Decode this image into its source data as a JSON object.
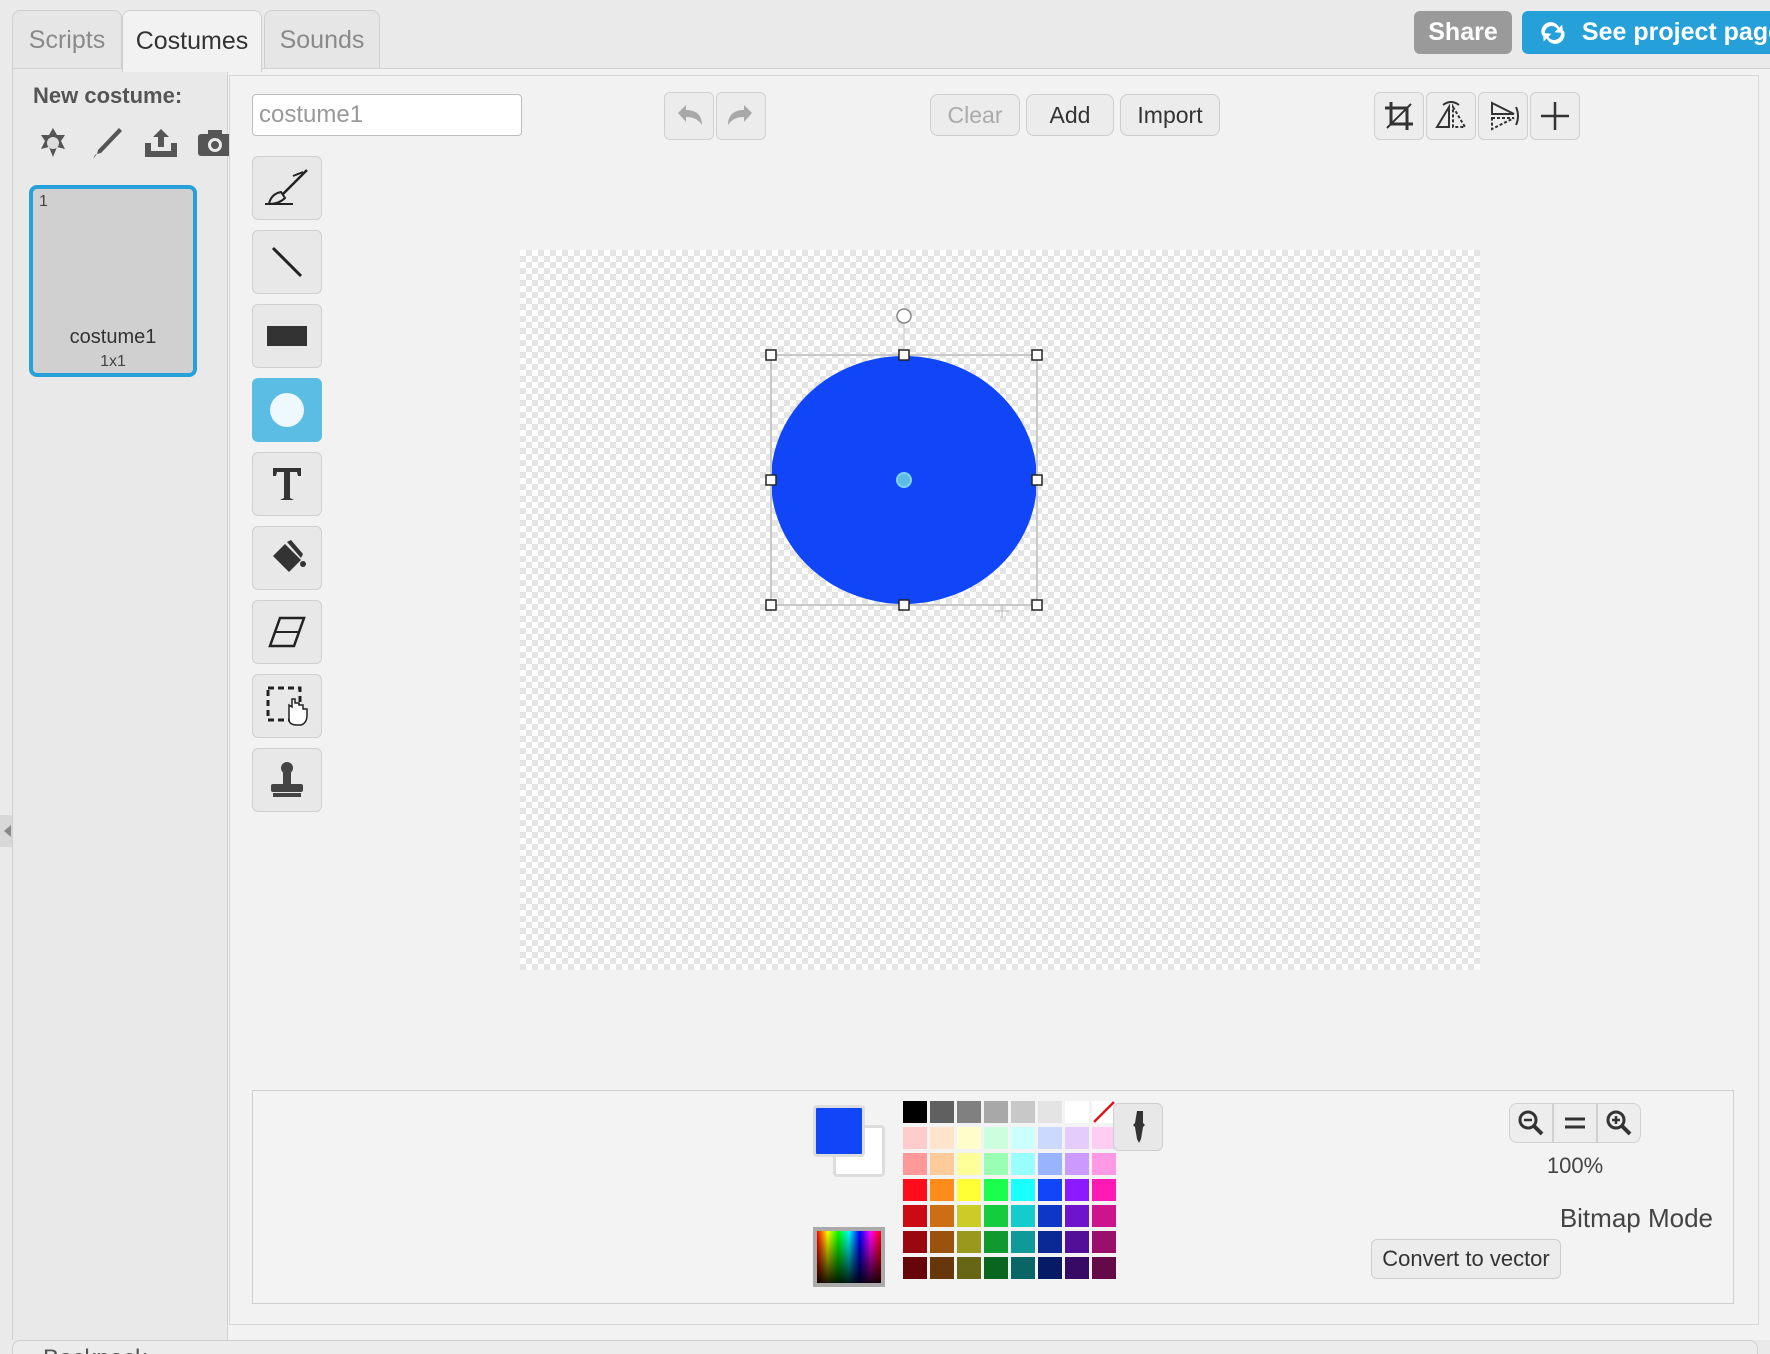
{
  "tabs": [
    {
      "label": "Scripts"
    },
    {
      "label": "Costumes"
    },
    {
      "label": "Sounds"
    }
  ],
  "topbar": {
    "share_label": "Share",
    "project_page_label": "See project page"
  },
  "sidebar": {
    "new_costume_label": "New costume:",
    "new_icons": [
      "choose-from-library-icon",
      "paint-new-icon",
      "upload-icon",
      "camera-icon"
    ],
    "costume": {
      "number": "1",
      "name": "costume1",
      "size": "1x1"
    }
  },
  "editor": {
    "costume_name_value": "costume1",
    "clear_label": "Clear",
    "add_label": "Add",
    "import_label": "Import",
    "tools": [
      "brush-icon",
      "line-icon",
      "rectangle-icon",
      "ellipse-icon",
      "text-icon",
      "fill-icon",
      "eraser-icon",
      "select-icon",
      "stamp-icon"
    ],
    "active_tool": "ellipse-icon",
    "transform_tools": [
      "crop-icon",
      "flip-horizontal-icon",
      "flip-vertical-icon",
      "set-costume-center-icon"
    ]
  },
  "bottom": {
    "primary_color": "#1046f8",
    "secondary_color": "#ffffff",
    "zoom_level": "100%",
    "mode_label": "Bitmap Mode",
    "convert_label": "Convert to vector",
    "palette": [
      "#000000",
      "#606060",
      "#808080",
      "#a8a8a8",
      "#c8c8c8",
      "#e4e4e4",
      "#ffffff",
      "none",
      "#ffcccc",
      "#ffe4cc",
      "#ffffcc",
      "#ccffdd",
      "#ccffff",
      "#ccd9ff",
      "#e4ccff",
      "#ffccf2",
      "#ff9999",
      "#ffcc99",
      "#ffff99",
      "#99ffb3",
      "#99ffff",
      "#99b3ff",
      "#cc99ff",
      "#ff99e6",
      "#ff0d1a",
      "#ff8c1a",
      "#ffff33",
      "#1aff4d",
      "#1affff",
      "#1046f8",
      "#8c1aff",
      "#ff1ab3",
      "#cc0a14",
      "#cc6f14",
      "#cccc28",
      "#14cc3d",
      "#14cccc",
      "#0d37c6",
      "#6f14cc",
      "#cc148f",
      "#99070f",
      "#99530f",
      "#99991e",
      "#0f992e",
      "#0f9999",
      "#0a2995",
      "#530f99",
      "#990f6b",
      "#66050a",
      "#66370a",
      "#666614",
      "#0a661f",
      "#0a6666",
      "#061b63",
      "#370a66",
      "#660a47"
    ]
  },
  "footer": {
    "backpack_label": "Backpack"
  },
  "colors": {
    "accent": "#25a0d9",
    "selected_tool": "#5bbde3",
    "circle_fill": "#1046f8"
  }
}
